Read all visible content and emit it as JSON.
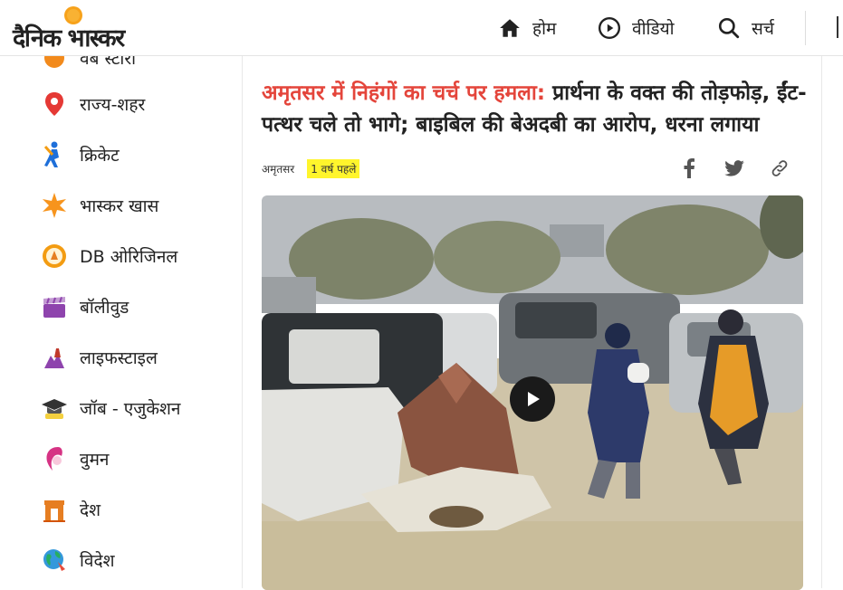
{
  "brand": {
    "logo_text": "दैनिक भास्कर"
  },
  "nav": [
    {
      "label": "होम",
      "icon": "home-icon"
    },
    {
      "label": "वीडियो",
      "icon": "play-circle-icon"
    },
    {
      "label": "सर्च",
      "icon": "search-icon"
    }
  ],
  "sidebar": {
    "items": [
      {
        "label": "वेब स्टोरी",
        "icon": "web-story-icon",
        "color": "#f28a1c"
      },
      {
        "label": "राज्य-शहर",
        "icon": "location-pin-icon",
        "color": "#e53935"
      },
      {
        "label": "क्रिकेट",
        "icon": "cricket-player-icon",
        "color": "#1e6fd9"
      },
      {
        "label": "भास्कर खास",
        "icon": "star-burst-icon",
        "color": "#f7941d"
      },
      {
        "label": "DB ओरिजिनल",
        "icon": "db-original-icon",
        "color": "#f39c12"
      },
      {
        "label": "बॉलीवुड",
        "icon": "clapperboard-icon",
        "color": "#8e44ad"
      },
      {
        "label": "लाइफस्टाइल",
        "icon": "lifestyle-icon",
        "color": "#c0392b"
      },
      {
        "label": "जॉब - एजुकेशन",
        "icon": "graduation-cap-icon",
        "color": "#333333"
      },
      {
        "label": "वुमन",
        "icon": "woman-icon",
        "color": "#d63384"
      },
      {
        "label": "देश",
        "icon": "india-gate-icon",
        "color": "#e67e22"
      },
      {
        "label": "विदेश",
        "icon": "globe-icon",
        "color": "#27ae60"
      }
    ]
  },
  "article": {
    "headline_red": "अमृतसर में निहंगों का चर्च पर हमला:",
    "headline_rest": " प्रार्थना के वक्त की तोड़फोड़, ईंट-पत्थर चले तो भागे; बाइबिल की बेअदबी का आरोप, धरना लगाया",
    "location": "अमृतसर",
    "time_ago": "1 वर्ष पहले",
    "share_icons": [
      "facebook-icon",
      "twitter-icon",
      "link-icon"
    ]
  },
  "colors": {
    "accent_red": "#e4453b",
    "highlight_yellow": "#fff52c"
  }
}
